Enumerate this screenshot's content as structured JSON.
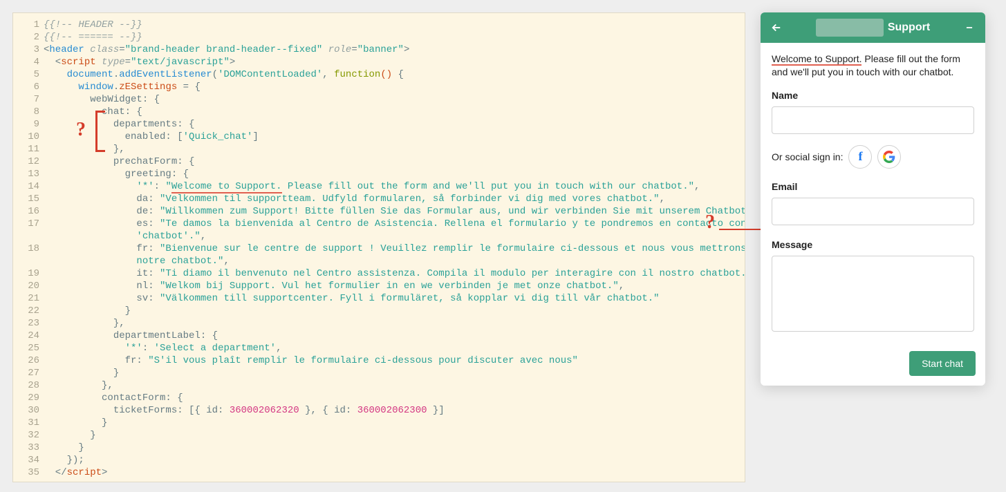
{
  "editor": {
    "totalLines": 35,
    "wrappedLines": [
      17,
      18
    ],
    "tokens": [
      [
        [
          "{{!-- HEADER --}}",
          "c-comment"
        ]
      ],
      [
        [
          "{{!-- ====== --}}",
          "c-comment"
        ]
      ],
      [
        [
          "<",
          "c-punct"
        ],
        [
          "header",
          "c-tag"
        ],
        [
          " ",
          ""
        ],
        [
          "class",
          "c-attr"
        ],
        [
          "=",
          "c-op"
        ],
        [
          "\"brand-header brand-header--fixed\"",
          "c-str"
        ],
        [
          " ",
          ""
        ],
        [
          "role",
          "c-attr"
        ],
        [
          "=",
          "c-op"
        ],
        [
          "\"banner\"",
          "c-str"
        ],
        [
          ">",
          "c-punct"
        ]
      ],
      [
        [
          "  <",
          "c-punct"
        ],
        [
          "script",
          "c-script"
        ],
        [
          " ",
          ""
        ],
        [
          "type",
          "c-attr"
        ],
        [
          "=",
          "c-op"
        ],
        [
          "\"text/javascript\"",
          "c-str"
        ],
        [
          ">",
          "c-punct"
        ]
      ],
      [
        [
          "    ",
          ""
        ],
        [
          "document",
          "c-ident"
        ],
        [
          ".",
          "c-punct"
        ],
        [
          "addEventListener",
          "c-ident"
        ],
        [
          "(",
          "c-punct"
        ],
        [
          "'DOMContentLoaded'",
          "c-str"
        ],
        [
          ", ",
          "c-punct"
        ],
        [
          "function",
          "c-kw"
        ],
        [
          "()",
          "c-orange"
        ],
        [
          " {",
          "c-punct"
        ]
      ],
      [
        [
          "      ",
          ""
        ],
        [
          "window",
          "c-ident"
        ],
        [
          ".",
          "c-punct"
        ],
        [
          "zESettings",
          "c-orange"
        ],
        [
          " = {",
          "c-op"
        ]
      ],
      [
        [
          "        webWidget: {",
          "c-prop"
        ]
      ],
      [
        [
          "          chat: {",
          "c-prop"
        ]
      ],
      [
        [
          "            departments: {",
          "c-prop"
        ]
      ],
      [
        [
          "              enabled: [",
          "c-prop"
        ],
        [
          "'Quick_chat'",
          "c-str"
        ],
        [
          "]",
          "c-prop"
        ]
      ],
      [
        [
          "            },",
          "c-prop"
        ]
      ],
      [
        [
          "            prechatForm: {",
          "c-prop"
        ]
      ],
      [
        [
          "              greeting: {",
          "c-prop"
        ]
      ],
      [
        [
          "                ",
          ""
        ],
        [
          "'*'",
          "c-str"
        ],
        [
          ": ",
          "c-prop"
        ],
        [
          "\"",
          "c-str"
        ],
        [
          "Welcome to Support.",
          "c-str hl-underline"
        ],
        [
          " Please fill out the form and we'll put you in touch with our chatbot.\"",
          "c-str"
        ],
        [
          ",",
          "c-prop"
        ]
      ],
      [
        [
          "                da: ",
          "c-prop"
        ],
        [
          "\"Velkommen til supportteam. Udfyld formularen, så forbinder vi dig med vores chatbot.\"",
          "c-str"
        ],
        [
          ",",
          "c-prop"
        ]
      ],
      [
        [
          "                de: ",
          "c-prop"
        ],
        [
          "\"Willkommen zum Support! Bitte füllen Sie das Formular aus, und wir verbinden Sie mit unserem Chatbot.\"",
          "c-str"
        ],
        [
          ",",
          "c-prop"
        ]
      ],
      [
        [
          "                es: ",
          "c-prop"
        ],
        [
          "\"Te damos la bienvenida al Centro de Asistencia. Rellena el formulario y te pondremos en contacto con nuestro ",
          "c-str"
        ]
      ],
      [
        [
          "                ",
          ""
        ],
        [
          "'chatbot'.\"",
          "c-str"
        ],
        [
          ",",
          "c-prop"
        ]
      ],
      [
        [
          "                fr: ",
          "c-prop"
        ],
        [
          "\"Bienvenue sur le centre de support ! Veuillez remplir le formulaire ci-dessous et nous vous mettrons en relation avec ",
          "c-str"
        ]
      ],
      [
        [
          "                ",
          ""
        ],
        [
          "notre chatbot.\"",
          "c-str"
        ],
        [
          ",",
          "c-prop"
        ]
      ],
      [
        [
          "                it: ",
          "c-prop"
        ],
        [
          "\"Ti diamo il benvenuto nel Centro assistenza. Compila il modulo per interagire con il nostro chatbot.\"",
          "c-str"
        ],
        [
          ",",
          "c-prop"
        ]
      ],
      [
        [
          "                nl: ",
          "c-prop"
        ],
        [
          "\"Welkom bij Support. Vul het formulier in en we verbinden je met onze chatbot.\"",
          "c-str"
        ],
        [
          ",",
          "c-prop"
        ]
      ],
      [
        [
          "                sv: ",
          "c-prop"
        ],
        [
          "\"Välkommen till supportcenter. Fyll i formuläret, så kopplar vi dig till vår chatbot.\"",
          "c-str"
        ]
      ],
      [
        [
          "              }",
          "c-prop"
        ]
      ],
      [
        [
          "            },",
          "c-prop"
        ]
      ],
      [
        [
          "            departmentLabel: {",
          "c-prop"
        ]
      ],
      [
        [
          "              ",
          ""
        ],
        [
          "'*'",
          "c-str"
        ],
        [
          ": ",
          "c-prop"
        ],
        [
          "'Select a department'",
          "c-str"
        ],
        [
          ",",
          "c-prop"
        ]
      ],
      [
        [
          "              fr: ",
          "c-prop"
        ],
        [
          "\"S'il vous plaît remplir le formulaire ci-dessous pour discuter avec nous\"",
          "c-str"
        ]
      ],
      [
        [
          "            }",
          "c-prop"
        ]
      ],
      [
        [
          "          },",
          "c-prop"
        ]
      ],
      [
        [
          "          contactForm: {",
          "c-prop"
        ]
      ],
      [
        [
          "            ticketForms: [{ id: ",
          "c-prop"
        ],
        [
          "360002062320",
          "c-num"
        ],
        [
          " }, { id: ",
          "c-prop"
        ],
        [
          "360002062300",
          "c-num"
        ],
        [
          " }]",
          "c-prop"
        ]
      ],
      [
        [
          "          }",
          "c-prop"
        ]
      ],
      [
        [
          "        }",
          "c-prop"
        ]
      ],
      [
        [
          "      }",
          "c-prop"
        ]
      ],
      [
        [
          "    });",
          "c-prop"
        ]
      ],
      [
        [
          "  </",
          "c-punct"
        ],
        [
          "script",
          "c-script"
        ],
        [
          ">",
          "c-punct"
        ]
      ]
    ]
  },
  "annotations": {
    "q1": "?",
    "q2": "?"
  },
  "widget": {
    "title": "Support",
    "greeting_hl": "Welcome to Support.",
    "greeting_rest": " Please fill out the form and we'll put you in touch with our chatbot.",
    "labels": {
      "name": "Name",
      "email": "Email",
      "message": "Message",
      "social": "Or social sign in:"
    },
    "social": {
      "facebook": "f",
      "google": "G"
    },
    "start": "Start chat"
  }
}
